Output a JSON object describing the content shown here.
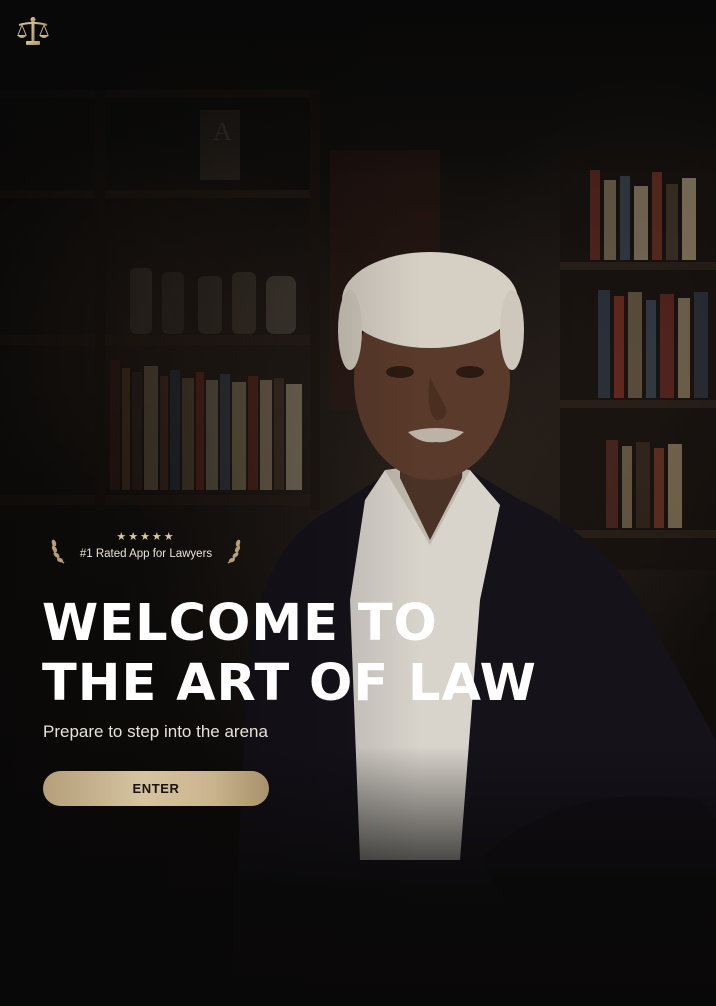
{
  "brand": {
    "logo_icon": "scales-of-justice-icon",
    "accent_color": "#c8b38d"
  },
  "badge": {
    "stars": "★★★★★",
    "rating": 5,
    "text": "#1 Rated App for Lawyers"
  },
  "hero": {
    "headline_line1": "WELCOME TO",
    "headline_line2": "THE ART OF LAW",
    "subtitle": "Prepare to step into the arena"
  },
  "actions": {
    "enter_label": "ENTER"
  }
}
